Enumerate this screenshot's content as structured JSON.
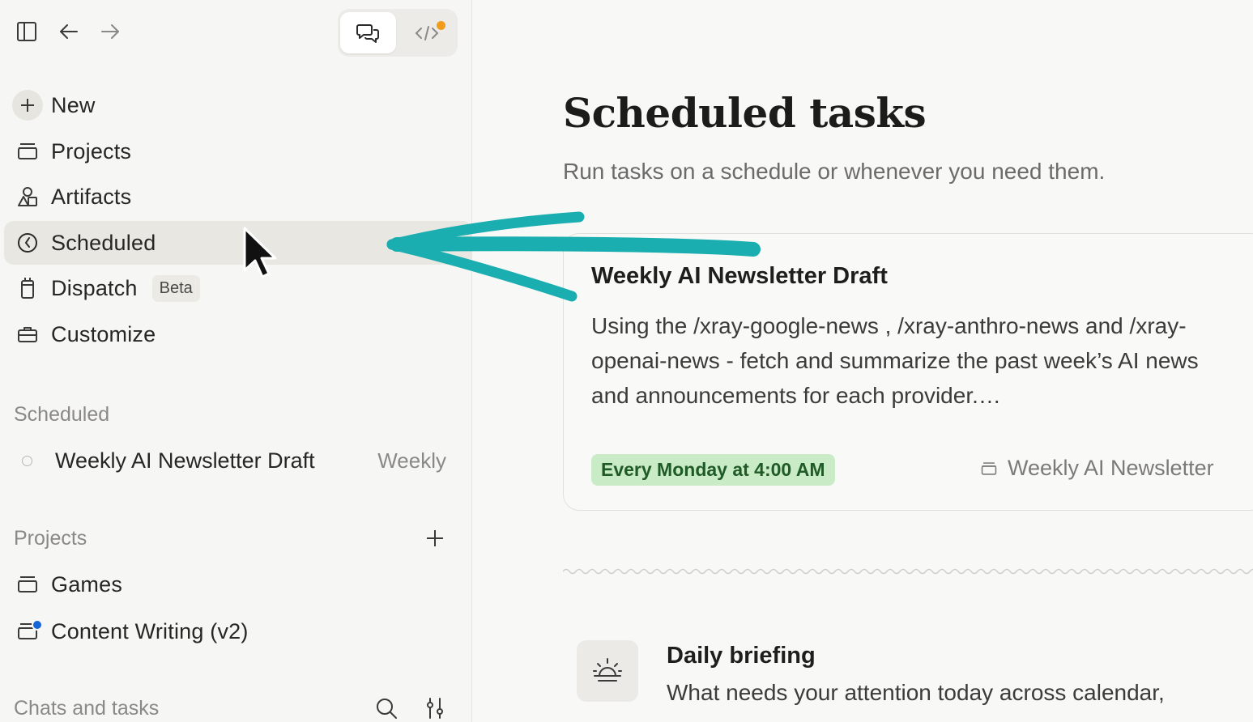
{
  "sidebar": {
    "nav": [
      {
        "label": "New",
        "icon": "plus-icon"
      },
      {
        "label": "Projects",
        "icon": "folder-icon"
      },
      {
        "label": "Artifacts",
        "icon": "shapes-icon"
      },
      {
        "label": "Scheduled",
        "icon": "clock-icon"
      },
      {
        "label": "Dispatch",
        "icon": "phone-icon",
        "badge": "Beta"
      },
      {
        "label": "Customize",
        "icon": "briefcase-icon"
      }
    ],
    "scheduled_section": {
      "label": "Scheduled",
      "items": [
        {
          "name": "Weekly AI Newsletter Draft",
          "frequency": "Weekly"
        }
      ]
    },
    "projects_section": {
      "label": "Projects",
      "items": [
        {
          "name": "Games"
        },
        {
          "name": "Content Writing (v2)"
        }
      ]
    },
    "chats_section": {
      "label": "Chats and tasks"
    }
  },
  "main": {
    "title": "Scheduled tasks",
    "subtitle": "Run tasks on a schedule or whenever you need them.",
    "task_card": {
      "title": "Weekly AI Newsletter Draft",
      "description": "Using the /xray-google-news , /xray-anthro-news and /xray-openai-news - fetch and summarize the past week’s AI news and announcements for each provider.…",
      "schedule": "Every Monday at 4:00 AM",
      "project": "Weekly AI Newsletter"
    },
    "suggestion": {
      "title": "Daily briefing",
      "description": "What needs your attention today across calendar,"
    }
  },
  "colors": {
    "accent_arrow": "#1aaeb0",
    "badge_bg": "#c9ecc7",
    "badge_text": "#1f5a27",
    "notification_dot": "#f29d1a",
    "project_dot": "#1565d8"
  }
}
